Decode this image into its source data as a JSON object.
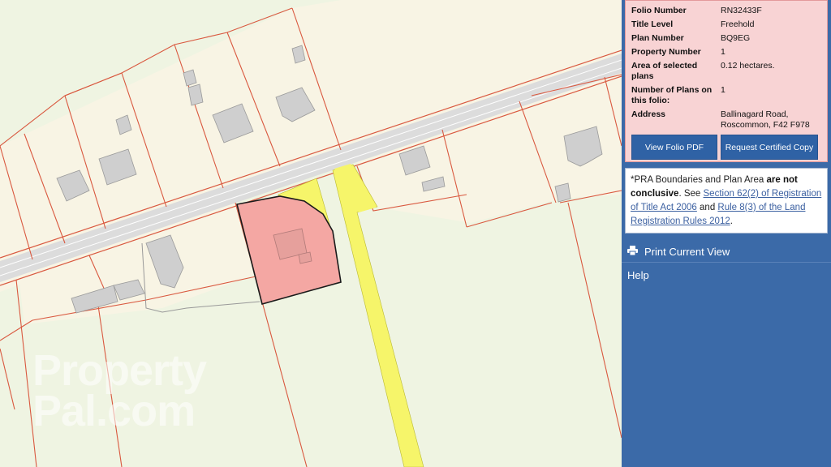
{
  "folio": {
    "rows": [
      {
        "key": "Folio Number",
        "value": "RN32433F"
      },
      {
        "key": "Title Level",
        "value": "Freehold"
      },
      {
        "key": "Plan Number",
        "value": "BQ9EG"
      },
      {
        "key": "Property Number",
        "value": "1"
      },
      {
        "key": "Area of selected plans",
        "value": "0.12 hectares."
      },
      {
        "key": "Number of Plans on this folio:",
        "value": "1"
      },
      {
        "key": "Address",
        "value": "Ballinagard Road, Roscommon, F42 F978"
      }
    ],
    "view_pdf_label": "View Folio PDF",
    "request_copy_label": "Request Certified Copy"
  },
  "note": {
    "prefix": "*PRA Boundaries and Plan Area ",
    "bold": "are not conclusive",
    "mid": ". See ",
    "link1": "Section 62(2) of Registration of Title Act 2006",
    "and": " and ",
    "link2": "Rule 8(3) of the Land Registration Rules 2012",
    "end": "."
  },
  "menu": {
    "print_label": "Print Current View",
    "help_label": "Help"
  },
  "watermark": {
    "line1": "Property",
    "line2": "Pal.com"
  },
  "colors": {
    "panel": "#3b6aa8",
    "info_bg": "#f8d3d4",
    "plot_fill": "#f4a7a3",
    "right_of_way": "#f6f56a",
    "boundary": "#d9583f"
  },
  "icons": {
    "print": "printer-icon"
  }
}
